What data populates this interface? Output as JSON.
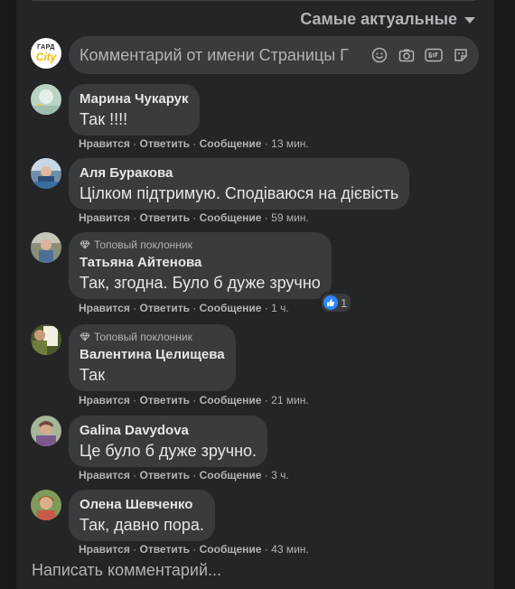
{
  "sort": {
    "label": "Самые актуальные"
  },
  "composer": {
    "page_logo_line1": "ГАРД",
    "page_logo_line2": "City",
    "placeholder": "Комментарий от имени Страницы Г"
  },
  "labels": {
    "like": "Нравится",
    "reply": "Ответить",
    "message": "Сообщение",
    "sep": " · "
  },
  "comments": [
    {
      "name": "Марина Чукарук",
      "text": "Так !!!!",
      "time": "13 мин.",
      "badge": ""
    },
    {
      "name": "Аля Буракова",
      "text": "Цілком підтримую. Сподіваюся на дієвість",
      "time": "59 мин.",
      "badge": ""
    },
    {
      "name": "Татьяна Айтенова",
      "text": "Так, згодна. Було б дуже зручно",
      "time": "1 ч.",
      "badge": "Топовый поклонник",
      "reactions": "1"
    },
    {
      "name": "Валентина Целищева",
      "text": "Так",
      "time": "21 мин.",
      "badge": "Топовый поклонник"
    },
    {
      "name": "Galina Davydova",
      "text": "Це було б дуже зручно.",
      "time": "3 ч.",
      "badge": ""
    },
    {
      "name": "Олена Шевченко",
      "text": "Так, давно пора.",
      "time": "43 мин.",
      "badge": ""
    }
  ],
  "footer": {
    "write_comment": "Написать комментарий..."
  },
  "colors": {
    "background": "#18191a",
    "panel": "#242526",
    "bubble": "#3a3b3c",
    "text": "#e4e6eb",
    "secondary": "#b0b3b8",
    "like": "#2d88ff"
  }
}
